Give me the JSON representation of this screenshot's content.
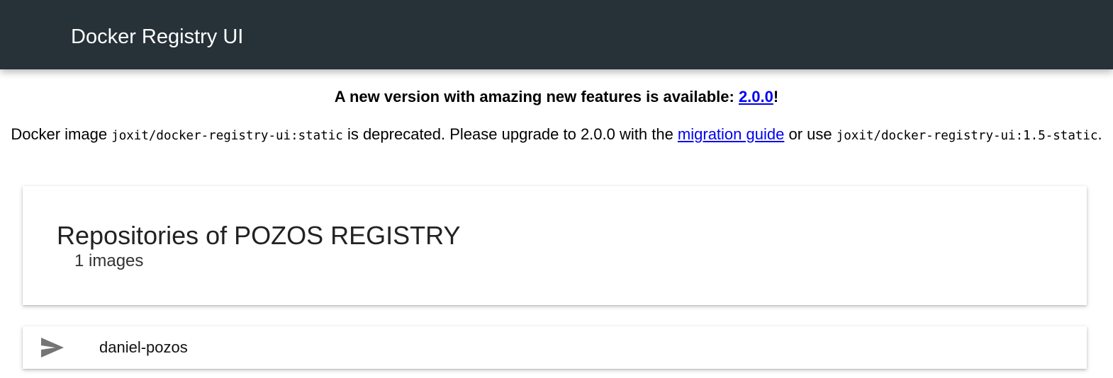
{
  "app": {
    "title": "Docker Registry UI"
  },
  "notice": {
    "new_version_text": "A new version with amazing new features is available: ",
    "new_version_link": "2.0.0",
    "new_version_suffix": "!",
    "deprecated_prefix": "Docker image ",
    "deprecated_image": "joxit/docker-registry-ui:static",
    "deprecated_middle": " is deprecated. Please upgrade to 2.0.0 with the ",
    "migration_link": "migration guide",
    "deprecated_or": " or use ",
    "alternative_image": "joxit/docker-registry-ui:1.5-static",
    "deprecated_end": "."
  },
  "repositories": {
    "title": "Repositories of POZOS REGISTRY",
    "count_label": "1 images",
    "items": [
      {
        "name": "daniel-pozos",
        "icon": "send-icon"
      }
    ]
  },
  "colors": {
    "app_bar": "#263238",
    "link": "#0000ee",
    "icon": "#757575"
  }
}
